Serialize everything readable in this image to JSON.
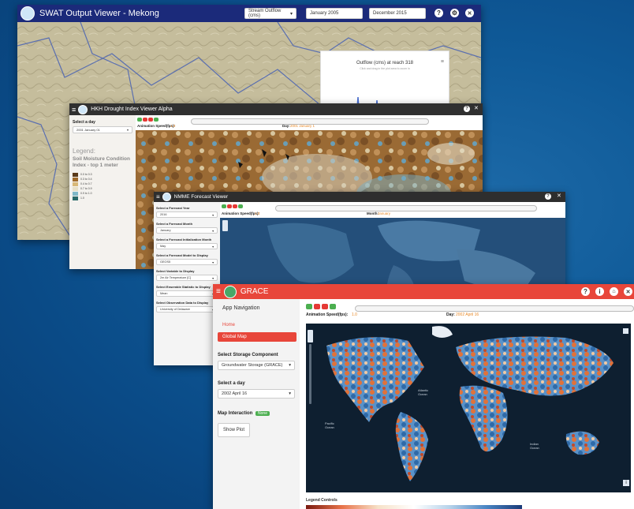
{
  "swat": {
    "title": "SWAT Output Viewer - Mekong",
    "variable": "Stream Outflow (cms)",
    "start_date": "January 2005",
    "end_date": "December 2015",
    "chart_title": "Outflow (cms) at reach 318",
    "chart_subtitle": "Click and drag in the plot area to zoom in"
  },
  "hkh": {
    "title": "HKH Drought Index Viewer Alpha",
    "select_day_label": "Select a day",
    "select_day_value": "2001 January 01",
    "animation_label": "Animation Speed(fps):",
    "animation_value": "1.0",
    "day_label": "Day:",
    "day_value": "2001 January 1",
    "legend_label": "Legend:",
    "legend_title": "Soil Moisture Condition Index - top 1 meter",
    "legend_items": [
      {
        "label": "0.0 to 0.3",
        "color": "#5a3a1a"
      },
      {
        "label": "0.3 to 0.4",
        "color": "#a06a2a"
      },
      {
        "label": "0.4 to 0.7",
        "color": "#d8b878"
      },
      {
        "label": "0.7 to 0.9",
        "color": "#e8e0c8"
      },
      {
        "label": "0.9 to 1.0",
        "color": "#80b8c8"
      },
      {
        "label": "1.0",
        "color": "#2a6a6a"
      }
    ]
  },
  "nmme": {
    "title": "NMME Forecast Viewer",
    "animation_label": "Animation Speed(fps):",
    "animation_value": "1.0",
    "month_label": "Month:",
    "month_value": "January",
    "fields": [
      {
        "label": "Select a Forecast Year",
        "value": "2016"
      },
      {
        "label": "Select a Forecast Month",
        "value": "January"
      },
      {
        "label": "Select a Forecast Initialization Month",
        "value": "May"
      },
      {
        "label": "Select a Forecast Model to Display",
        "value": "GEOS5"
      },
      {
        "label": "Select Variable to Display",
        "value": "2m Air Temperature [C]"
      },
      {
        "label": "Select Ensemble Statistic to Display",
        "value": "Mean"
      },
      {
        "label": "Select Observation Data to Display",
        "value": "University of Delaware"
      }
    ]
  },
  "grace": {
    "title": "GRACE",
    "nav_title": "App Navigation",
    "nav_home": "Home",
    "nav_global": "Global Map",
    "storage_label": "Select Storage Component",
    "storage_value": "Groundwater Storage (GRACE)",
    "day_select_label": "Select a day",
    "day_select_value": "2002 April 16",
    "interaction_label": "Map Interaction",
    "interaction_badge": "None",
    "show_plot": "Show Plot",
    "animation_label": "Animation Speed(fps):",
    "animation_value": "1.0",
    "day_label": "Day:",
    "day_value": "2002 April 16",
    "ocean_pacific": "Pacific Ocean",
    "ocean_atlantic": "Atlantic Ocean",
    "ocean_indian": "Indian Ocean",
    "legend_controls": "Legend Controls"
  },
  "colors": {
    "swat_bar": "#1b2a7a",
    "grace_bar": "#e8463a",
    "dark_bar": "#303030",
    "play_green": "#4caf50",
    "play_red": "#e53935"
  }
}
